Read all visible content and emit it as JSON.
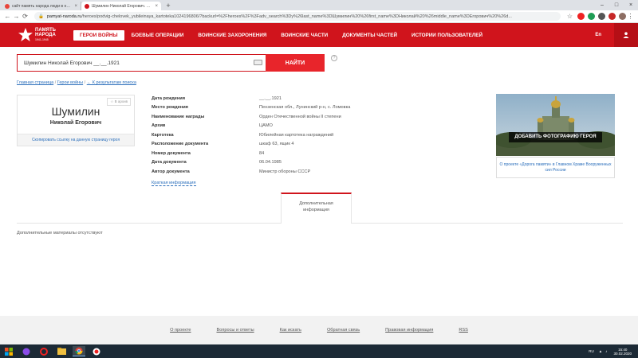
{
  "browser": {
    "tabs": [
      {
        "title": "сайт память народа люди в направлении",
        "active": false,
        "fav_color": "#e8453c"
      },
      {
        "title": "Шумилин Николай Егорович. Орден",
        "active": true,
        "fav_color": "#d0141c"
      }
    ],
    "url_host": "pamyat-naroda.ru",
    "url_path": "/heroes/podvig-chelovek_yubileinaya_kartoteka1024196806/?backurl=%2Fheroes%2F%3Fadv_search%3Dy%26last_name%3DШумилин%20%26first_name%3DНиколай%20%26middle_name%3DЕгорович%20%26d..."
  },
  "site": {
    "logo_line1": "ПАМЯТЬ",
    "logo_line2": "НАРОДА",
    "logo_years": "1941-1945",
    "nav": [
      "ГЕРОИ ВОЙНЫ",
      "БОЕВЫЕ ОПЕРАЦИИ",
      "ВОИНСКИЕ ЗАХОРОНЕНИЯ",
      "ВОИНСКИЕ ЧАСТИ",
      "ДОКУМЕНТЫ ЧАСТЕЙ",
      "ИСТОРИИ ПОЛЬЗОВАТЕЛЕЙ"
    ],
    "lang": "En"
  },
  "search": {
    "value": "Шумилин Николай Егорович __.__.1921",
    "button": "НАЙТИ",
    "help": "?"
  },
  "breadcrumb": {
    "home": "Главная страница",
    "sep": " / ",
    "section": "Герои войны",
    "back": "← К результатам поиска"
  },
  "hero": {
    "surname": "Шумилин",
    "name": "Николай Егорович",
    "favorite": "☆ В архив",
    "copy_link": "Скопировать ссылку на данную страницу героя"
  },
  "details": [
    {
      "label": "Дата рождения",
      "value": "__.__.1921"
    },
    {
      "label": "Место рождения",
      "value": "Пензенская обл., Лунинский р-н, с. Ломовка"
    },
    {
      "label": "Наименование награды",
      "value": "Орден Отечественной войны II степени"
    },
    {
      "label": "Архив",
      "value": "ЦАМО"
    },
    {
      "label": "Картотека",
      "value": "Юбилейная картотека награждений"
    },
    {
      "label": "Расположение документа",
      "value": "шкаф 63, ящик 4"
    },
    {
      "label": "Номер документа",
      "value": "84"
    },
    {
      "label": "Дата документа",
      "value": "06.04.1985"
    },
    {
      "label": "Автор документа",
      "value": "Министр обороны СССР"
    }
  ],
  "brief_link": "Краткая информация",
  "banner": {
    "button": "ДОБАВИТЬ ФОТОГРАФИЮ ГЕРОЯ",
    "promo": "О проекте «Дорога памяти» в Главном Храме Вооруженных сил России"
  },
  "tab": {
    "line1": "Дополнительная",
    "line2": "информация"
  },
  "extra_text": "Дополнительные материалы отсутствуют",
  "footer": [
    "О проекте",
    "Вопросы и ответы",
    "Как искать",
    "Обратная связь",
    "Правовая информация",
    "RSS"
  ],
  "taskbar": {
    "lang": "RU",
    "time": "15:40",
    "date": "30.02.2020"
  },
  "colors": {
    "brand_red": "#d0141c",
    "search_btn": "#e8252b",
    "link_blue": "#2a6ebb"
  }
}
